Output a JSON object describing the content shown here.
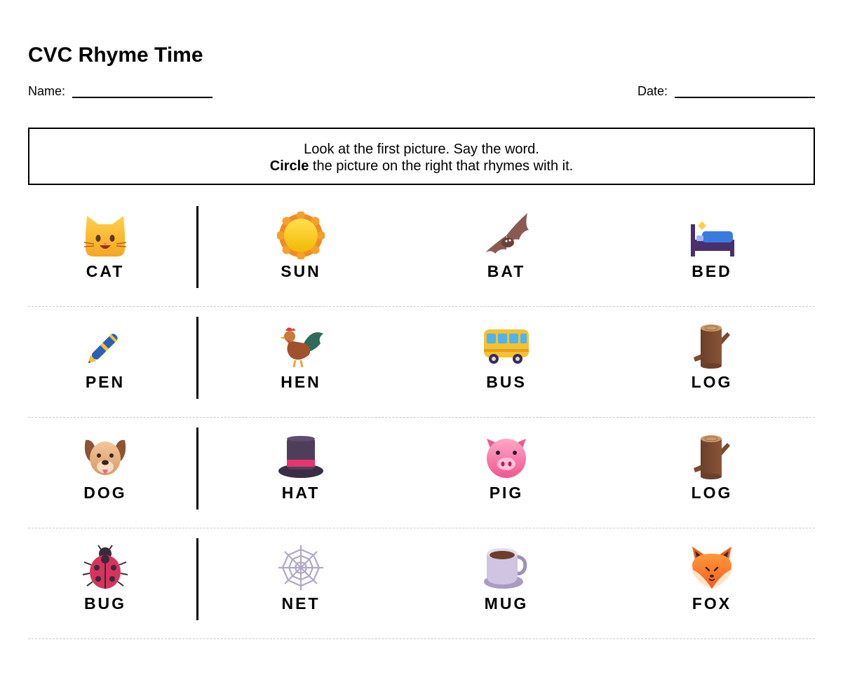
{
  "title": "CVC Rhyme Time",
  "name_label": "Name:",
  "date_label": "Date:",
  "instructions": {
    "line1": "Look at the first picture. Say the word.",
    "line2_bold": "Circle",
    "line2_rest": " the picture on the right that rhymes with it."
  },
  "rows": [
    {
      "target": {
        "word": "CAT",
        "icon": "cat-face-icon"
      },
      "choices": [
        {
          "word": "SUN",
          "icon": "sun-icon"
        },
        {
          "word": "BAT",
          "icon": "bat-icon"
        },
        {
          "word": "BED",
          "icon": "bed-icon"
        }
      ]
    },
    {
      "target": {
        "word": "PEN",
        "icon": "pen-icon"
      },
      "choices": [
        {
          "word": "HEN",
          "icon": "rooster-icon"
        },
        {
          "word": "BUS",
          "icon": "bus-icon"
        },
        {
          "word": "LOG",
          "icon": "log-icon"
        }
      ]
    },
    {
      "target": {
        "word": "DOG",
        "icon": "dog-face-icon"
      },
      "choices": [
        {
          "word": "HAT",
          "icon": "top-hat-icon"
        },
        {
          "word": "PIG",
          "icon": "pig-face-icon"
        },
        {
          "word": "LOG",
          "icon": "log-icon"
        }
      ]
    },
    {
      "target": {
        "word": "BUG",
        "icon": "ladybug-icon"
      },
      "choices": [
        {
          "word": "NET",
          "icon": "spider-web-icon"
        },
        {
          "word": "MUG",
          "icon": "mug-icon"
        },
        {
          "word": "FOX",
          "icon": "fox-face-icon"
        }
      ]
    }
  ]
}
